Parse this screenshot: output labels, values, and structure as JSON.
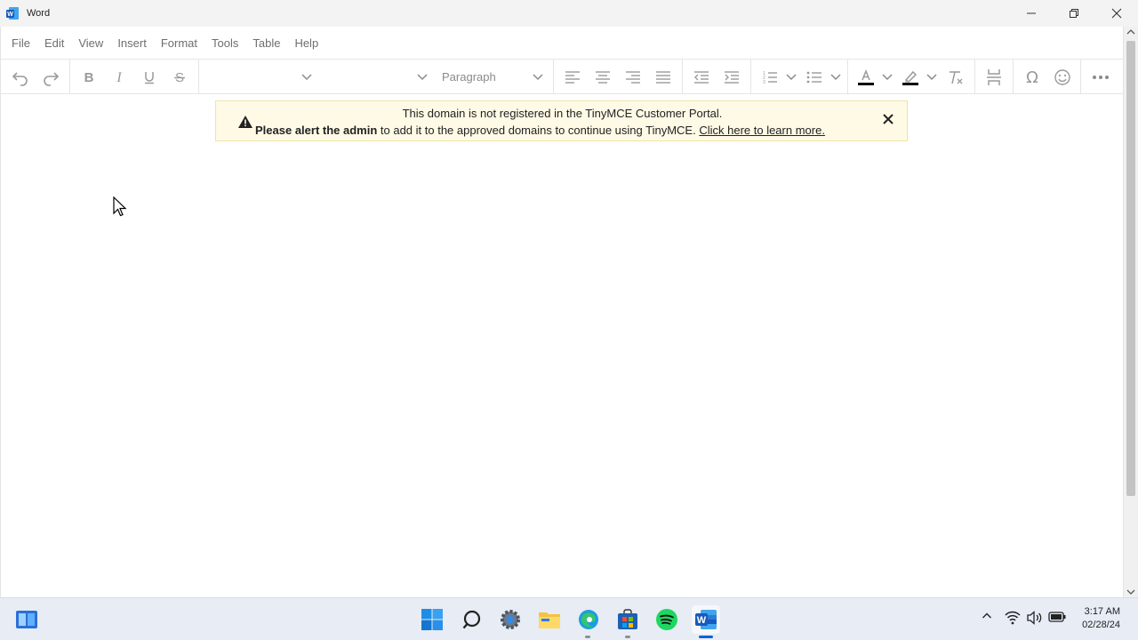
{
  "window": {
    "title": "Word"
  },
  "menubar": {
    "items": [
      "File",
      "Edit",
      "View",
      "Insert",
      "Format",
      "Tools",
      "Table",
      "Help"
    ]
  },
  "toolbar": {
    "block_format": "Paragraph",
    "font_family": "",
    "font_size": "",
    "text_color": "#000000",
    "highlight_color": "#000000"
  },
  "notice": {
    "line1": "This domain is not registered in the TinyMCE Customer Portal.",
    "line2_bold": "Please alert the admin",
    "line2_text": " to add it to the approved domains to continue using TinyMCE. ",
    "line2_link": "Click here to learn more."
  },
  "taskbar": {
    "time": "3:17 AM",
    "date": "02/28/24",
    "accent": "#0a63d6"
  }
}
